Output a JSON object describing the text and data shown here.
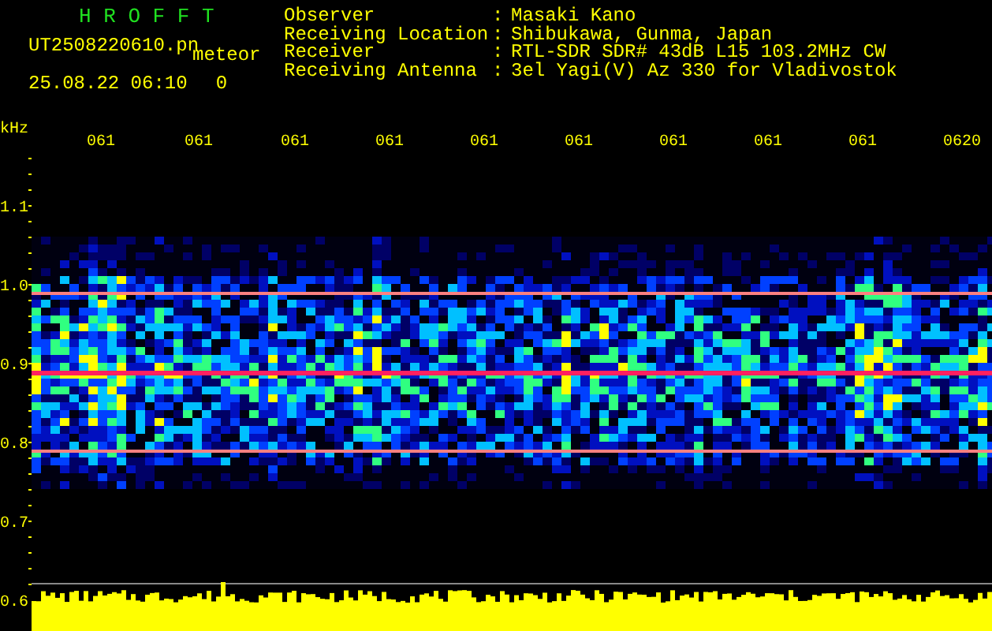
{
  "app_title": "H R O F F T",
  "file_name": "UT2508220610.pn",
  "detection_type": "meteor",
  "timestamp": "25.08.22 06:10",
  "count": "0",
  "info": [
    {
      "label": "Observer",
      "separator": ":",
      "value": "Masaki Kano"
    },
    {
      "label": "Receiving Location",
      "separator": ":",
      "value": "Shibukawa, Gunma, Japan"
    },
    {
      "label": "Receiver",
      "separator": ":",
      "value": "RTL-SDR SDR# 43dB L15 103.2MHz CW"
    },
    {
      "label": "Receiving Antenna",
      "separator": ":",
      "value": "3el Yagi(V) Az 330 for Vladivostok"
    }
  ],
  "freq_unit": "kHz",
  "time_labels": [
    "061",
    "061",
    "061",
    "061",
    "061",
    "061",
    "061",
    "061",
    "061",
    "0620"
  ],
  "freq_labels": [
    "1.1",
    "1.0",
    "0.9",
    "0.8",
    "0.7",
    "0.6"
  ]
}
